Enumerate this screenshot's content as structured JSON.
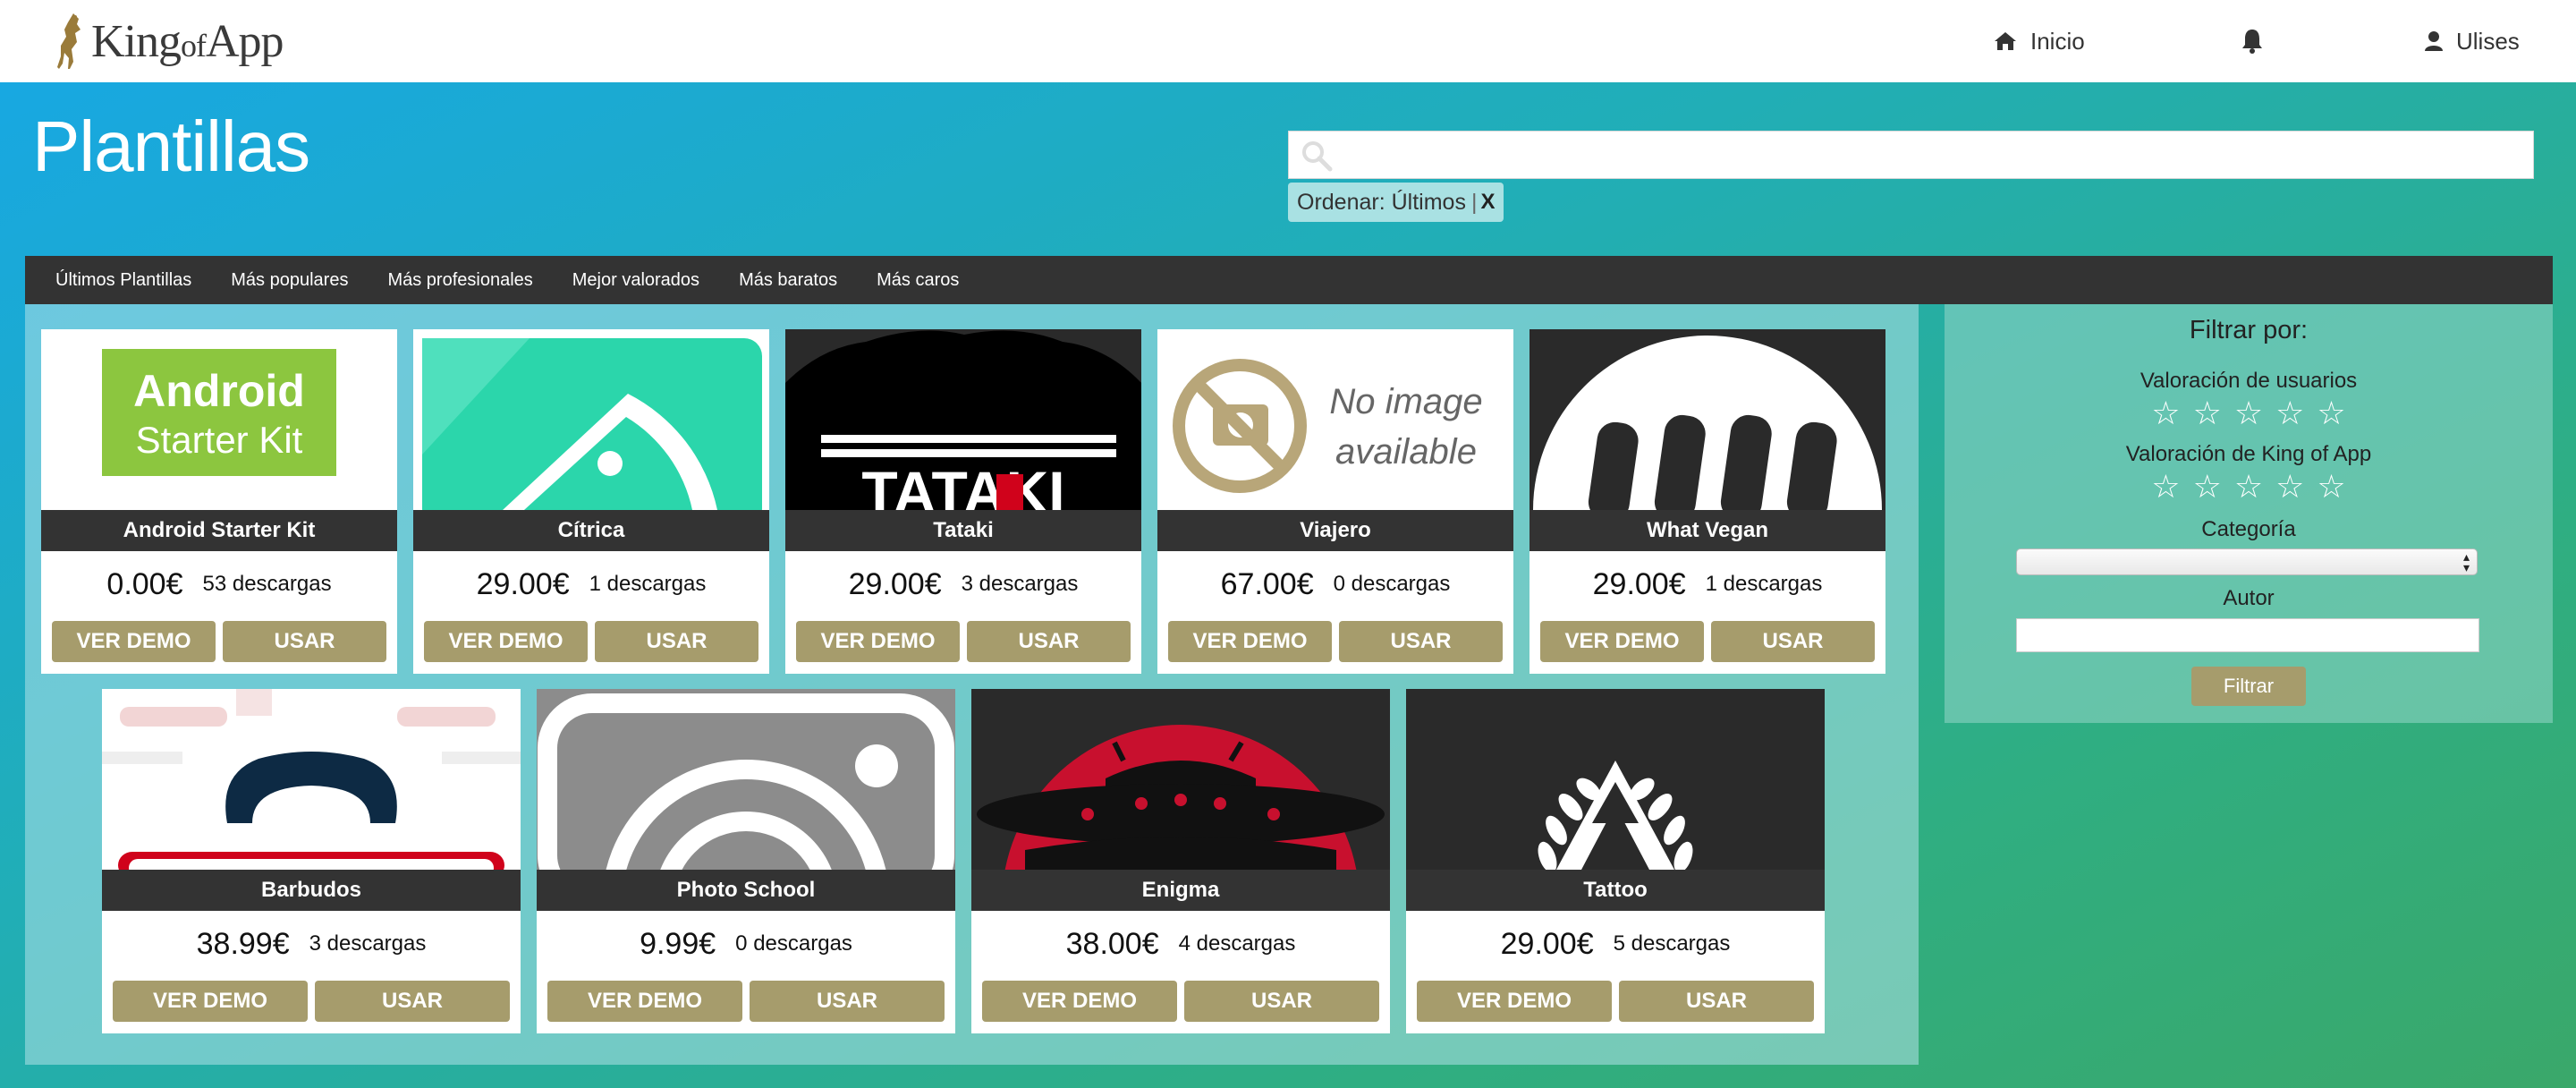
{
  "app": {
    "logo_text_a": "King",
    "logo_text_b": "of",
    "logo_text_c": "App"
  },
  "nav": {
    "home_label": "Inicio",
    "user_label": "Ulises"
  },
  "header": {
    "title": "Plantillas",
    "search_placeholder": "",
    "order_chip_label": "Ordenar: Últimos",
    "order_chip_separator": "|",
    "order_chip_close": "X"
  },
  "categories": [
    "Últimos Plantillas",
    "Más populares",
    "Más profesionales",
    "Mejor valorados",
    "Más baratos",
    "Más caros"
  ],
  "cards": [
    {
      "name": "Android Starter Kit",
      "price": "0.00€",
      "downloads": "53 descargas",
      "thumb_text_1": "Android",
      "thumb_text_2": "Starter Kit"
    },
    {
      "name": "Cítrica",
      "price": "29.00€",
      "downloads": "1 descargas"
    },
    {
      "name": "Tataki",
      "price": "29.00€",
      "downloads": "3 descargas",
      "thumb_text_1": "TATAKI"
    },
    {
      "name": "Viajero",
      "price": "67.00€",
      "downloads": "0 descargas",
      "thumb_text_1": "No image",
      "thumb_text_2": "available"
    },
    {
      "name": "What Vegan",
      "price": "29.00€",
      "downloads": "1 descargas"
    },
    {
      "name": "Barbudos",
      "price": "38.99€",
      "downloads": "3 descargas"
    },
    {
      "name": "Photo School",
      "price": "9.99€",
      "downloads": "0 descargas"
    },
    {
      "name": "Enigma",
      "price": "38.00€",
      "downloads": "4 descargas"
    },
    {
      "name": "Tattoo",
      "price": "29.00€",
      "downloads": "5 descargas"
    }
  ],
  "card_buttons": {
    "demo_label": "VER DEMO",
    "use_label": "USAR"
  },
  "filter": {
    "title": "Filtrar por:",
    "user_rating_label": "Valoración de usuarios",
    "koa_rating_label": "Valoración de King of App",
    "category_label": "Categoría",
    "category_selected": "",
    "author_label": "Autor",
    "author_value": "",
    "submit_label": "Filtrar",
    "star_glyph": "☆"
  },
  "colors": {
    "button_gold": "#a69c6c",
    "nav_dark": "#333333",
    "chip_bg": "#a9e1e3"
  },
  "icons": {
    "home": "home-icon",
    "bell": "bell-icon",
    "user": "user-icon",
    "search": "search-icon",
    "close": "close-icon",
    "star": "star-icon"
  }
}
